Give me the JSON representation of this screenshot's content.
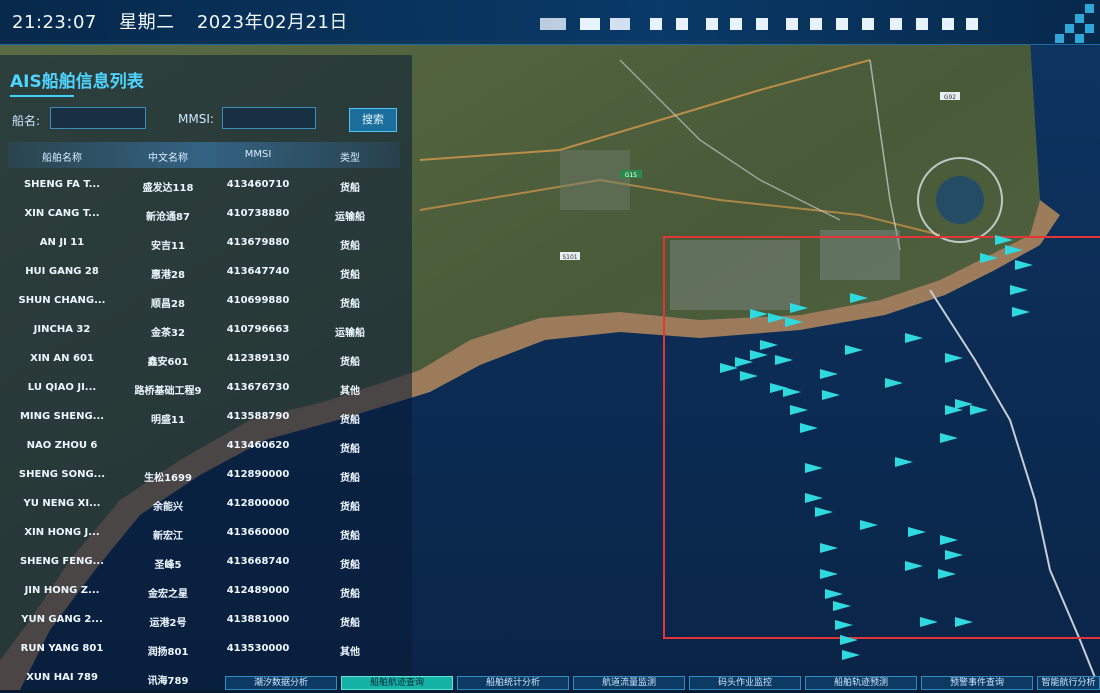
{
  "header": {
    "time": "21:23:07",
    "weekday": "星期二",
    "date": "2023年02月21日"
  },
  "panel": {
    "title": "AIS船舶信息列表",
    "ship_name_label": "船名:",
    "ship_name_value": "",
    "mmsi_label": "MMSI:",
    "mmsi_value": "",
    "search_label": "搜索",
    "columns": [
      "船舶名称",
      "中文名称",
      "MMSI",
      "类型"
    ],
    "rows": [
      [
        "SHENG FA T...",
        "盛发达118",
        "413460710",
        "货船"
      ],
      [
        "XIN CANG T...",
        "新沧通87",
        "410738880",
        "运输船"
      ],
      [
        "AN JI 11",
        "安吉11",
        "413679880",
        "货船"
      ],
      [
        "HUI GANG 28",
        "惠港28",
        "413647740",
        "货船"
      ],
      [
        "SHUN CHANG...",
        "顺昌28",
        "410699880",
        "货船"
      ],
      [
        "JINCHA 32",
        "金茶32",
        "410796663",
        "运输船"
      ],
      [
        "XIN AN 601",
        "鑫安601",
        "412389130",
        "货船"
      ],
      [
        "LU QIAO JI...",
        "路桥基础工程9",
        "413676730",
        "其他"
      ],
      [
        "MING SHENG...",
        "明盛11",
        "413588790",
        "货船"
      ],
      [
        "NAO ZHOU 6",
        "",
        "413460620",
        "货船"
      ],
      [
        "SHENG SONG...",
        "生松1699",
        "412890000",
        "货船"
      ],
      [
        "YU NENG XI...",
        "余能兴",
        "412800000",
        "货船"
      ],
      [
        "XIN HONG J...",
        "新宏江",
        "413660000",
        "货船"
      ],
      [
        "SHENG FENG...",
        "圣峰5",
        "413668740",
        "货船"
      ],
      [
        "JIN HONG Z...",
        "金宏之星",
        "412489000",
        "货船"
      ],
      [
        "YUN GANG 2...",
        "运港2号",
        "413881000",
        "货船"
      ],
      [
        "RUN YANG 801",
        "润扬801",
        "413530000",
        "其他"
      ],
      [
        "XUN HAI 789",
        "讯海789",
        "",
        ""
      ]
    ]
  },
  "tabs": [
    {
      "label": "潮汐数据分析"
    },
    {
      "label": "船舶航迹查询"
    },
    {
      "label": "船舶统计分析"
    },
    {
      "label": "航道流量监测"
    },
    {
      "label": "码头作业监控"
    },
    {
      "label": "船舶轨迹预测"
    },
    {
      "label": "预警事件查询"
    },
    {
      "label": "智能航行分析"
    }
  ],
  "map_labels": [
    "S101",
    "G15",
    "G92"
  ],
  "colors": {
    "sea": "#0b2d58",
    "land": "#4f5f3a",
    "shore": "#c69a68",
    "ship": "#2fd9e0",
    "monitor_box": "#e23636",
    "accent": "#3fd3ff"
  }
}
